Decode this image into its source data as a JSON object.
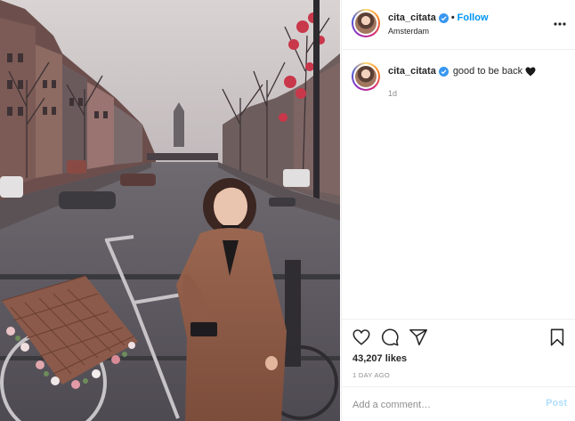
{
  "post": {
    "username": "cita_citata",
    "follow_label": "Follow",
    "separator": "•",
    "location": "Amsterdam",
    "caption_text": "good to be back",
    "caption_time": "1d",
    "likes": "43,207 likes",
    "posted_ago": "1 DAY AGO"
  },
  "comment": {
    "placeholder": "Add a comment…",
    "post_label": "Post"
  },
  "icons": {
    "verified": "verified-badge-icon",
    "more": "more-options-icon",
    "like": "heart-icon",
    "comment": "comment-icon",
    "share": "share-icon",
    "save": "bookmark-icon",
    "emoji": "black-heart-icon"
  },
  "colors": {
    "link_blue": "#0095f6",
    "verified_blue": "#3897f0",
    "post_disabled": "#b2dffc",
    "muted": "#8e8e8e",
    "border": "#efefef"
  }
}
